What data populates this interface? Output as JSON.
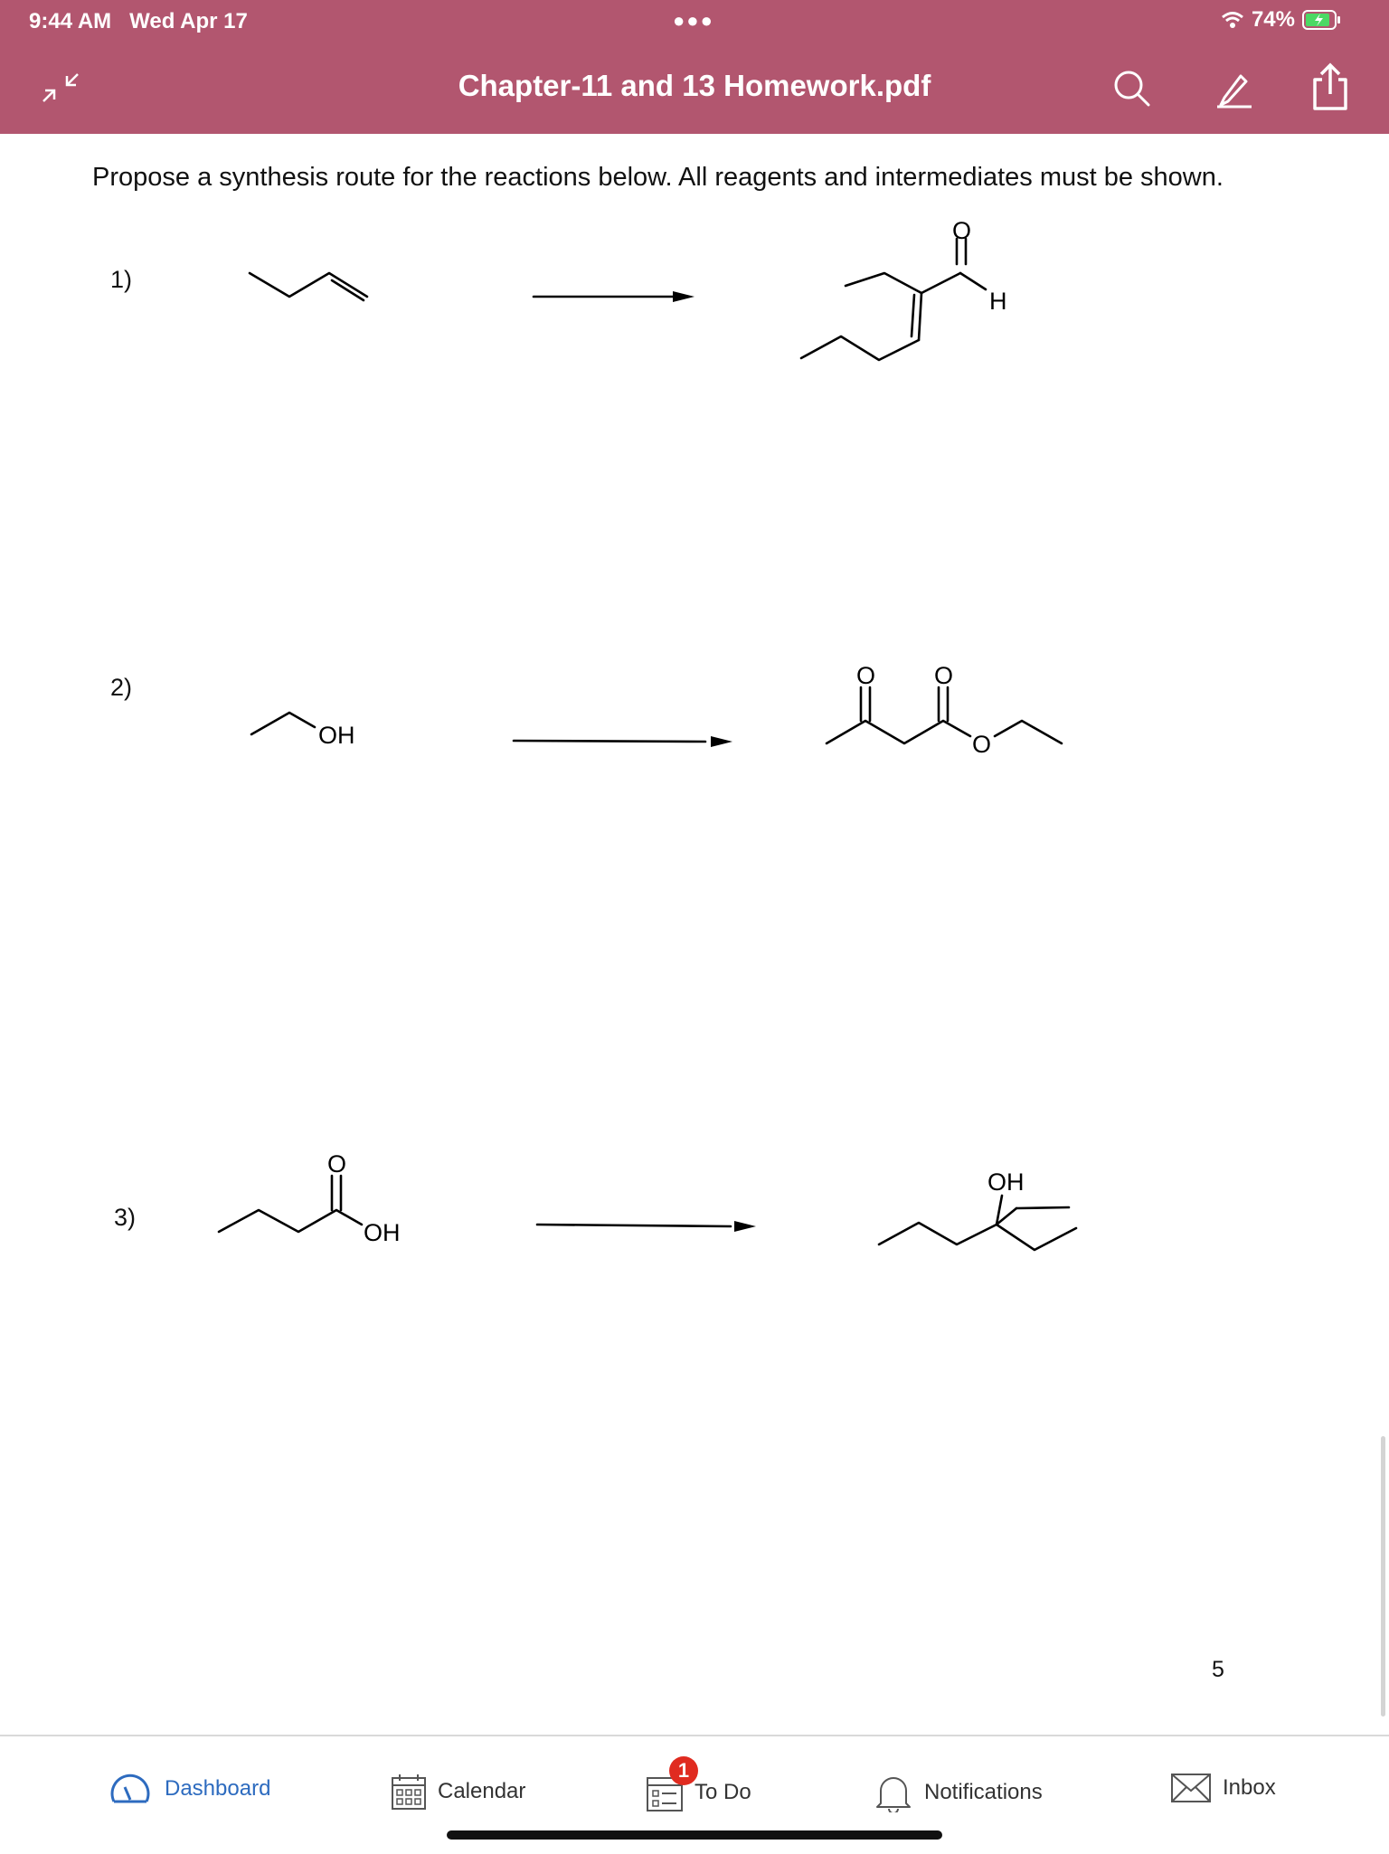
{
  "status_bar": {
    "time": "9:44 AM",
    "date": "Wed Apr 17",
    "battery": "74%"
  },
  "header": {
    "title": "Chapter-11 and 13 Homework.pdf"
  },
  "document": {
    "instruction": "Propose a synthesis route for the reactions below. All reagents and intermediates must be shown.",
    "problems": [
      {
        "number": "1)",
        "product_labels": [
          "O",
          "H"
        ]
      },
      {
        "number": "2)",
        "reactant_labels": [
          "OH"
        ],
        "product_labels": [
          "O",
          "O",
          "O"
        ]
      },
      {
        "number": "3)",
        "reactant_labels": [
          "O",
          "OH"
        ],
        "product_labels": [
          "OH"
        ]
      }
    ],
    "page_number": "5"
  },
  "tabbar": {
    "tabs": [
      {
        "label": "Dashboard",
        "icon": "dashboard-icon"
      },
      {
        "label": "Calendar",
        "icon": "calendar-icon"
      },
      {
        "label": "To Do",
        "icon": "todo-icon",
        "badge": "1"
      },
      {
        "label": "Notifications",
        "icon": "bell-icon"
      },
      {
        "label": "Inbox",
        "icon": "inbox-icon"
      }
    ]
  },
  "colors": {
    "header": "#b2566f",
    "active_tab": "#2d6bbf",
    "badge": "#e02b20",
    "battery_charge": "#4cd964"
  }
}
